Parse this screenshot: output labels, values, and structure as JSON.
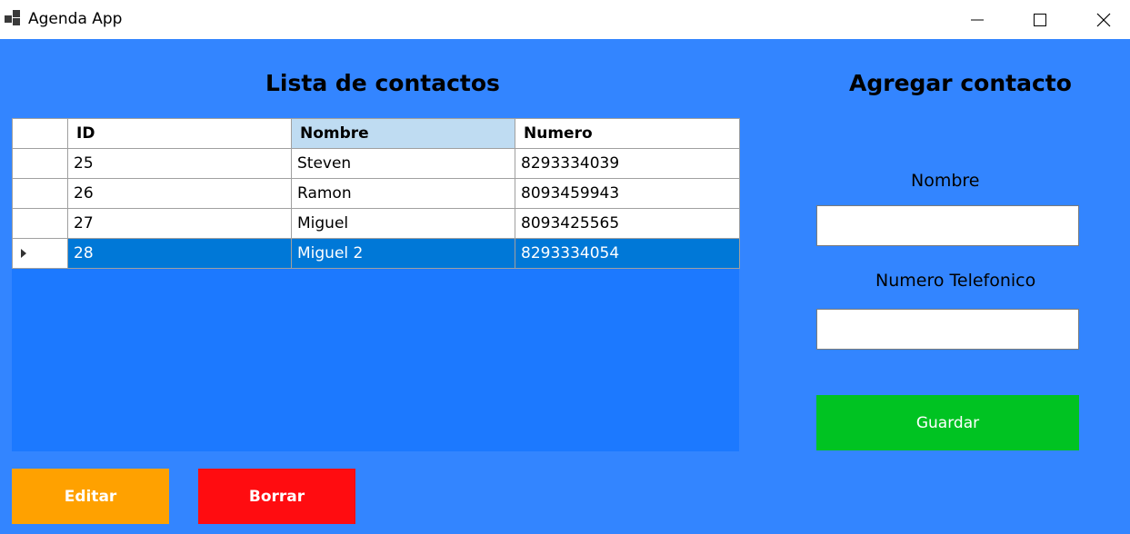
{
  "window": {
    "title": "Agenda App"
  },
  "list": {
    "heading": "Lista de contactos",
    "columns": [
      "ID",
      "Nombre",
      "Numero"
    ],
    "rows": [
      {
        "id": "25",
        "nombre": "Steven",
        "numero": "8293334039"
      },
      {
        "id": "26",
        "nombre": "Ramon",
        "numero": "8093459943"
      },
      {
        "id": "27",
        "nombre": "Miguel",
        "numero": "8093425565"
      },
      {
        "id": "28",
        "nombre": "Miguel 2",
        "numero": "8293334054"
      }
    ],
    "selected_row_index": 3
  },
  "form": {
    "heading": "Agregar contacto",
    "nombre_label": "Nombre",
    "nombre_value": "",
    "numero_label": "Numero Telefonico",
    "numero_value": "",
    "guardar_label": "Guardar"
  },
  "actions": {
    "editar_label": "Editar",
    "borrar_label": "Borrar"
  },
  "colors": {
    "background": "#3385ff",
    "grid_background": "#1c79ff",
    "selection": "#0078d7",
    "guardar": "#00c322",
    "editar": "#ffa100",
    "borrar": "#ff0c10"
  },
  "icons": {
    "app": "app-icon",
    "minimize": "minimize-icon",
    "maximize": "maximize-icon",
    "close": "close-icon",
    "row_pointer": "row-pointer-icon"
  }
}
